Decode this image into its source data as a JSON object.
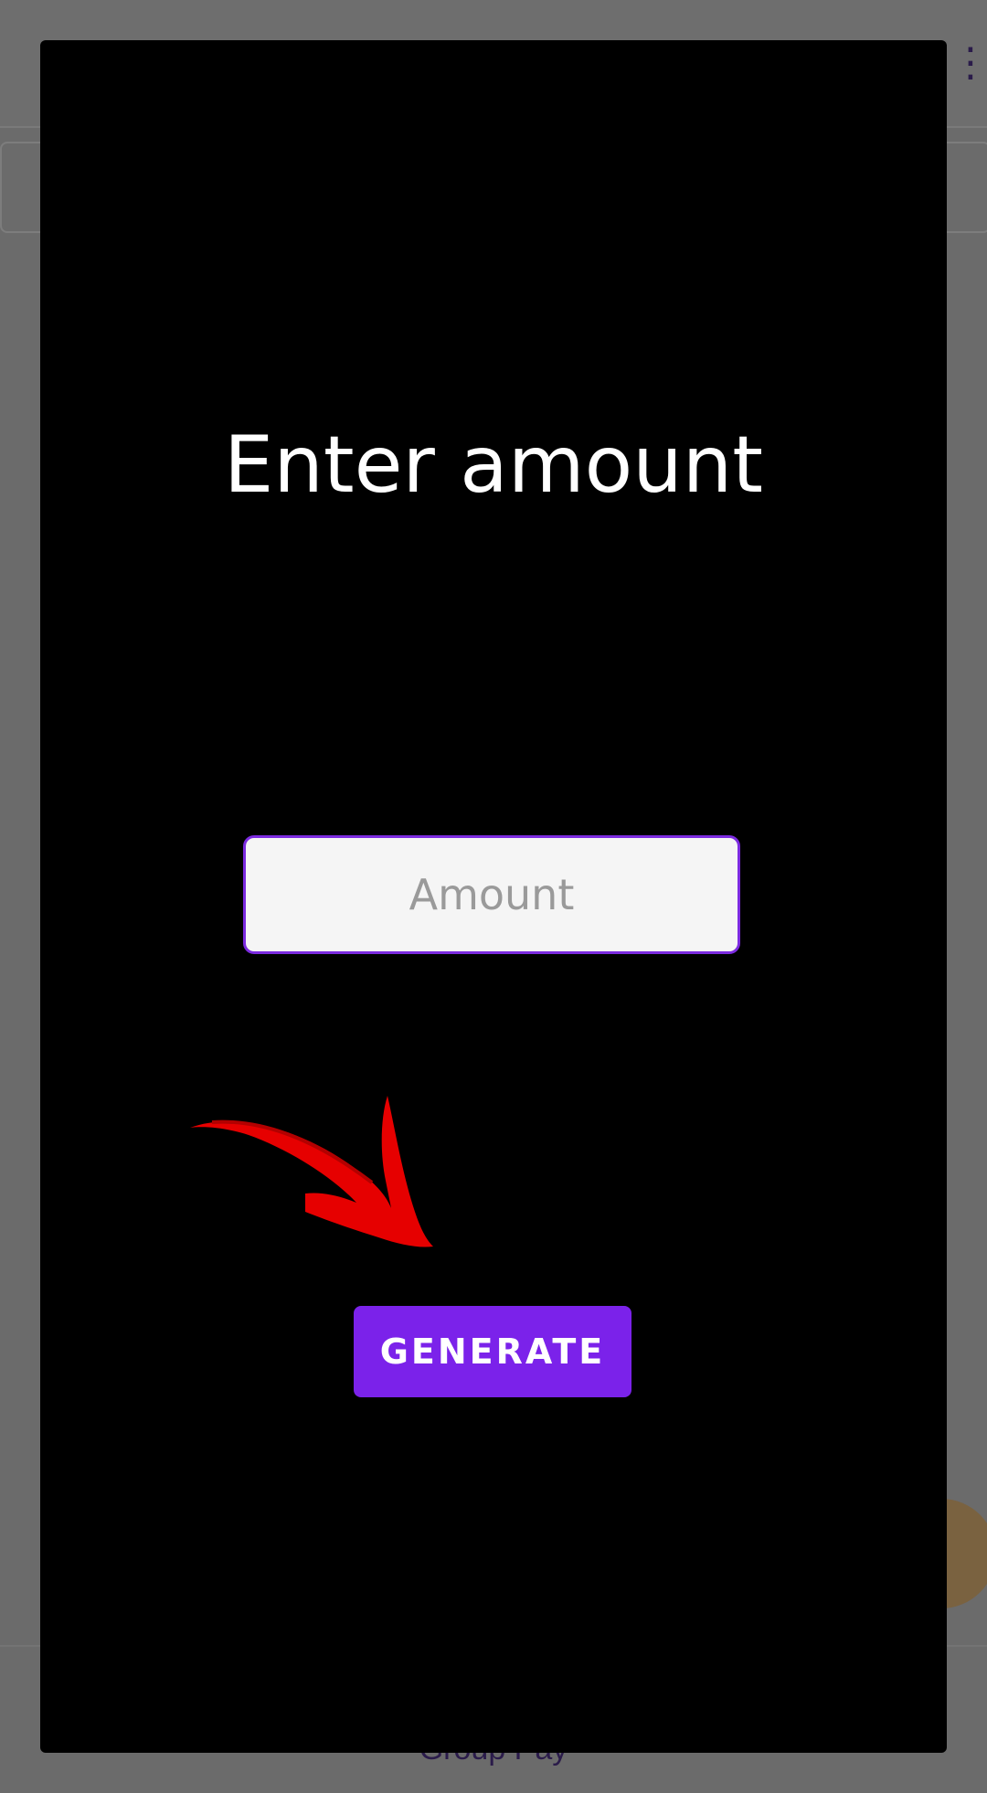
{
  "dialog": {
    "title": "Enter amount",
    "amount_input": {
      "value": "",
      "placeholder": "Amount"
    },
    "generate_label": "GENERATE"
  },
  "background": {
    "bottom_label": "Group Pay",
    "menu_icon": "more-vert-icon",
    "fab_icon": "fab-icon"
  },
  "colors": {
    "accent": "#7b22ea",
    "input_border": "#7c2be0",
    "arrow": "#e60000",
    "dialog_bg": "#000000"
  },
  "annotation": {
    "icon": "red-arrow-icon"
  }
}
